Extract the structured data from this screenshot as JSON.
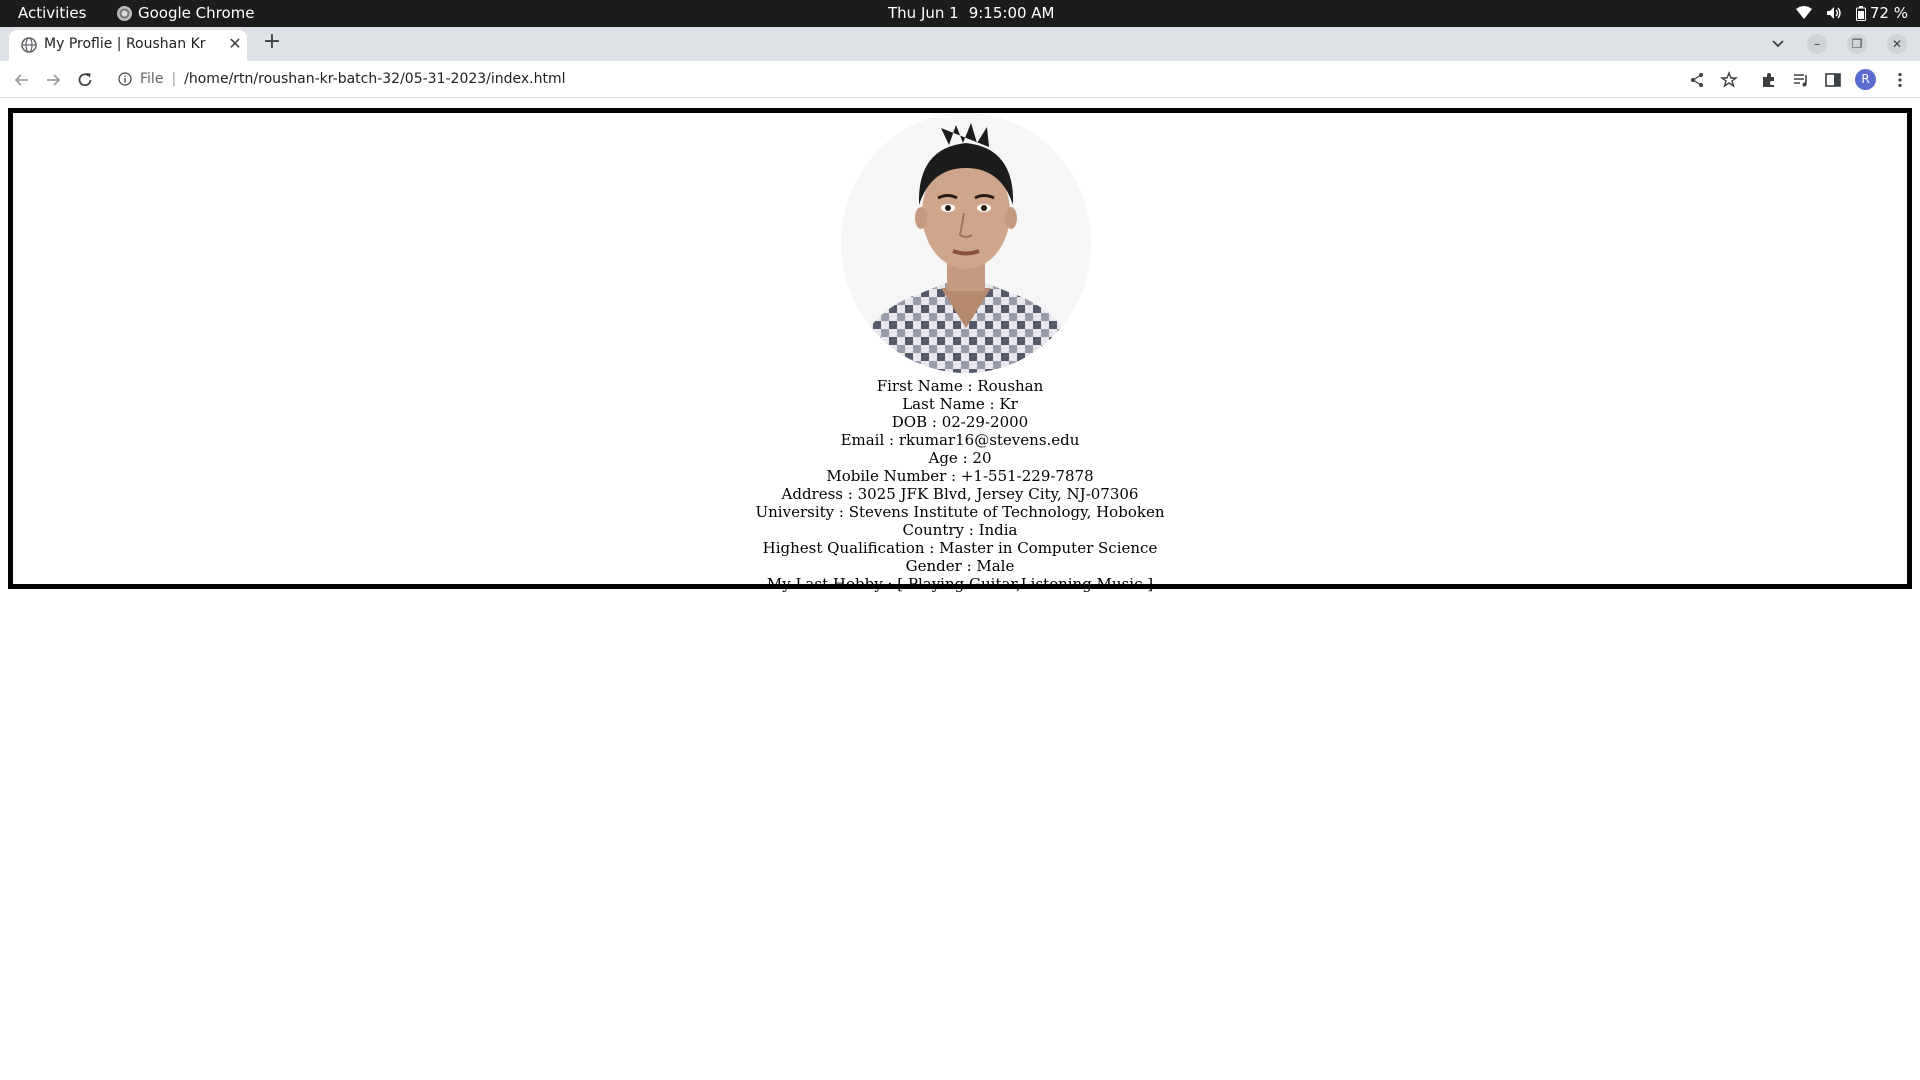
{
  "os_bar": {
    "activities": "Activities",
    "app_name": "Google Chrome",
    "date": "Thu Jun 1",
    "time": "9:15:00 AM",
    "battery": "72 %"
  },
  "browser": {
    "tab_title": "My Proflie | Roushan Kr",
    "address_scheme": "File",
    "address_path": "/home/rtn/roushan-kr-batch-32/05-31-2023/index.html",
    "profile_initial": "R"
  },
  "profile": {
    "first_name": "First Name : Roushan",
    "last_name": "Last Name : Kr",
    "dob": "DOB : 02-29-2000",
    "email": "Email : rkumar16@stevens.edu",
    "age": "Age : 20",
    "mobile": "Mobile Number : +1-551-229-7878",
    "address": "Address : 3025 JFK Blvd, Jersey City, NJ-07306",
    "university": "University : Stevens Institute of Technology, Hoboken",
    "country": "Country : India",
    "qualification": "Highest Qualification : Master in Computer Science",
    "gender": "Gender : Male",
    "hobby": "My Last Hobby : [ Playing Guitar,Listening Music ]"
  }
}
